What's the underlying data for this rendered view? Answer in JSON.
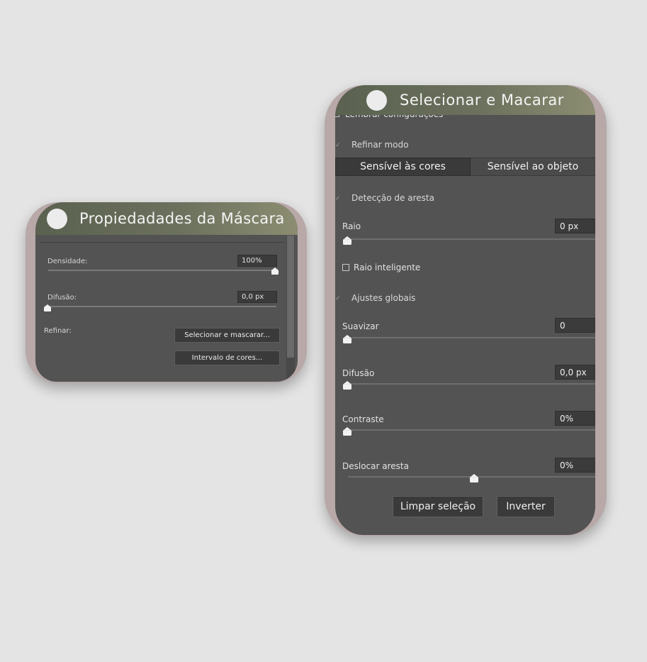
{
  "mask_panel": {
    "title": "Propiedadades da Máscara",
    "density": {
      "label": "Densidade:",
      "value": "100%",
      "slider_level": 1.0
    },
    "feather": {
      "label": "Difusão:",
      "value": "0,0 px",
      "slider_level": 0.0
    },
    "refine_label": "Refinar:",
    "buttons": {
      "select_and_mask": "Selecionar e mascarar...",
      "color_range": "Intervalo de cores..."
    }
  },
  "refine_panel": {
    "title": "Selecionar e Macarar",
    "remember_settings": "Lembrar configurações",
    "refine_mode": {
      "label": "Refinar modo",
      "options": [
        "Sensível às cores",
        "Sensível ao objeto"
      ],
      "selected": "Sensível às cores"
    },
    "edge_detection": {
      "label": "Detecção de aresta",
      "radius": {
        "label": "Raio",
        "value": "0 px",
        "slider_level": 0.0
      },
      "smart_radius": "Raio inteligente"
    },
    "global_refinements": {
      "label": "Ajustes globais",
      "smooth": {
        "label": "Suavizar",
        "value": "0",
        "slider_level": 0.0
      },
      "feather": {
        "label": "Difusão",
        "value": "0,0 px",
        "slider_level": 0.0
      },
      "contrast": {
        "label": "Contraste",
        "value": "0%",
        "slider_level": 0.0
      },
      "shift_edge": {
        "label": "Deslocar aresta",
        "value": "0%",
        "slider_level": 0.5
      }
    },
    "buttons": {
      "clear_selection": "Limpar seleção",
      "invert": "Inverter"
    }
  },
  "colors": {
    "panel_bg": "#535353",
    "frame": "#b8a8a8",
    "header_gradient_start": "#5b6150",
    "header_gradient_end": "#8c8d72"
  }
}
